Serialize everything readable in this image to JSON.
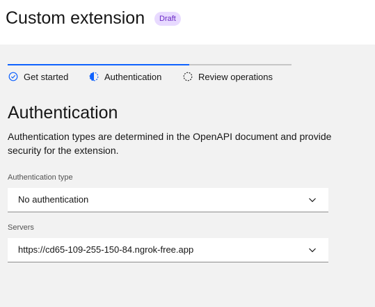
{
  "header": {
    "title": "Custom extension",
    "status_tag": "Draft"
  },
  "stepper": {
    "progress": 0.64,
    "steps": [
      {
        "label": "Get started",
        "state": "complete",
        "icon": "checkmark-outline-icon"
      },
      {
        "label": "Authentication",
        "state": "current",
        "icon": "incomplete-half-icon"
      },
      {
        "label": "Review operations",
        "state": "incomplete",
        "icon": "circle-dash-icon"
      }
    ]
  },
  "section": {
    "title": "Authentication",
    "description": "Authentication types are determined in the OpenAPI document and provide security for the extension."
  },
  "form": {
    "auth_type": {
      "label": "Authentication type",
      "value": "No authentication"
    },
    "servers": {
      "label": "Servers",
      "value": "https://cd65-109-255-150-84.ngrok-free.app"
    }
  },
  "colors": {
    "accent": "#0f62fe",
    "tag_bg": "#e8daff",
    "tag_text": "#6929c4",
    "page_bg": "#f2f2f2"
  }
}
